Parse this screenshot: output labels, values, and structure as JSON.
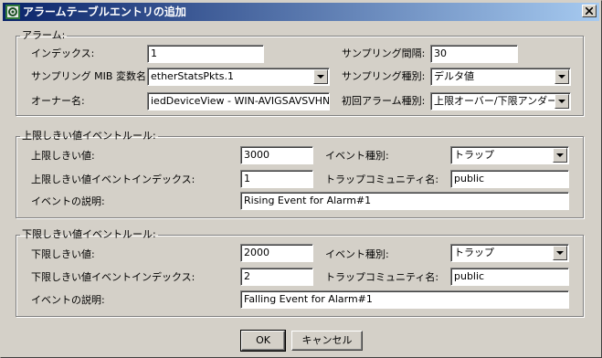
{
  "window": {
    "title": "アラームテーブルエントリの追加"
  },
  "alarm": {
    "legend": "アラーム:",
    "index_label": "インデックス:",
    "index_value": "1",
    "interval_label": "サンプリング間隔:",
    "interval_value": "30",
    "variable_label": "サンプリング MIB 変数名:",
    "variable_value": "etherStatsPkts.1",
    "sample_type_label": "サンプリング種別:",
    "sample_type_value": "デルタ値",
    "owner_label": "オーナー名:",
    "owner_value": "iedDeviceView - WIN-AVIGSAVSVHN",
    "startup_label": "初回アラーム種別:",
    "startup_value": "上限オーバー/下限アンダー"
  },
  "rising": {
    "legend": "上限しきい値イベントルール:",
    "threshold_label": "上限しきい値:",
    "threshold_value": "3000",
    "event_type_label": "イベント種別:",
    "event_type_value": "トラップ",
    "event_index_label": "上限しきい値イベントインデックス:",
    "event_index_value": "1",
    "community_label": "トラップコミュニティ名:",
    "community_value": "public",
    "description_label": "イベントの説明:",
    "description_value": "Rising Event for Alarm#1"
  },
  "falling": {
    "legend": "下限しきい値イベントルール:",
    "threshold_label": "下限しきい値:",
    "threshold_value": "2000",
    "event_type_label": "イベント種別:",
    "event_type_value": "トラップ",
    "event_index_label": "下限しきい値イベントインデックス:",
    "event_index_value": "2",
    "community_label": "トラップコミュニティ名:",
    "community_value": "public",
    "description_label": "イベントの説明:",
    "description_value": "Falling Event for Alarm#1"
  },
  "buttons": {
    "ok": "OK",
    "cancel": "キャンセル"
  },
  "icons": {
    "app": "network-device-icon",
    "close": "close-icon",
    "dropdown": "chevron-down-icon"
  },
  "colors": {
    "titlebar_start": "#0a246a",
    "titlebar_end": "#a6caf0",
    "face": "#d4d0c8"
  }
}
